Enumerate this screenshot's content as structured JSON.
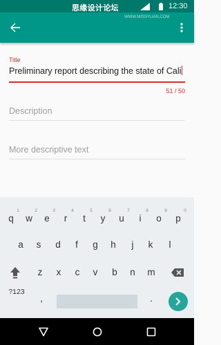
{
  "status_bar": {
    "watermark": "思缘设计论坛",
    "time": "12:30",
    "icons": [
      "signal-icon",
      "battery-icon"
    ]
  },
  "app_bar": {
    "back_icon": "arrow-back-icon",
    "menu_icon": "more-vert-icon",
    "color": "#009688",
    "status_color": "#00796b"
  },
  "form": {
    "title_label": "Title",
    "title_value": "Preliminary report describing the state of Cali",
    "counter": "51 / 50",
    "error_color": "#d32f2f",
    "description_placeholder": "Description",
    "more_placeholder": "More descriptive text"
  },
  "keyboard": {
    "row1": [
      {
        "k": "q",
        "h": "1"
      },
      {
        "k": "w",
        "h": "2"
      },
      {
        "k": "e",
        "h": "3"
      },
      {
        "k": "r",
        "h": "4"
      },
      {
        "k": "t",
        "h": "5"
      },
      {
        "k": "y",
        "h": "6"
      },
      {
        "k": "u",
        "h": "7"
      },
      {
        "k": "i",
        "h": "8"
      },
      {
        "k": "o",
        "h": "9"
      },
      {
        "k": "p",
        "h": "0"
      }
    ],
    "row2": [
      "a",
      "s",
      "d",
      "f",
      "g",
      "h",
      "j",
      "k",
      "l"
    ],
    "row3": [
      "z",
      "x",
      "c",
      "v",
      "b",
      "n",
      "m"
    ],
    "symbols": "?123",
    "comma": ",",
    "period": ".",
    "enter_color": "#26a69a"
  },
  "nav_bar": {
    "icons": [
      "nav-back-icon",
      "nav-home-icon",
      "nav-recents-icon"
    ]
  },
  "watermark_bottom_right": "WWW.MISSYUAN.COM"
}
